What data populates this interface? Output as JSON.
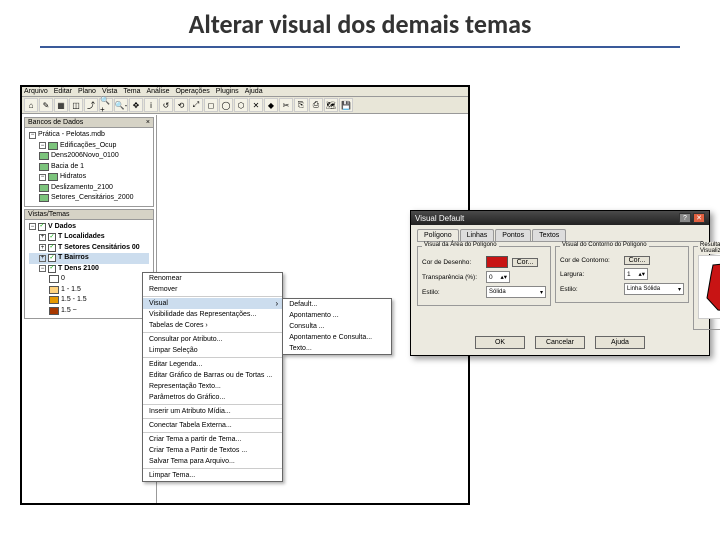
{
  "title": "Alterar visual dos demais temas",
  "menubar": [
    "Arquivo",
    "Editar",
    "Plano",
    "Vista",
    "Tema",
    "Análise",
    "Operações",
    "Plugins",
    "Ajuda"
  ],
  "toolbar_icons": [
    "⌂",
    "✎",
    "▦",
    "◫",
    "⤴",
    "🔍+",
    "🔍-",
    "✥",
    "i",
    "↺",
    "⟲",
    "⤢",
    "◻",
    "◯",
    "⬡",
    "✕",
    "◆",
    "✂",
    "⎘",
    "⎙",
    "🗺",
    "💾"
  ],
  "panels": {
    "db": {
      "title": "Bancos de Dados",
      "close": "×",
      "root": "Prática - Pelotas.mdb",
      "items": [
        "Edificações_Ocup",
        "Dens2006Novo_0100",
        "Bacia de 1",
        "Hidratos",
        "Deslizamento_2100",
        "Setores_Censitários_2000"
      ]
    },
    "views": {
      "title": "Vistas/Temas",
      "root": "V Dados",
      "themes": [
        {
          "label": "T Localidades",
          "chk": true
        },
        {
          "label": "T Setores Censitários 00",
          "chk": true
        },
        {
          "label": "T Bairros",
          "chk": true,
          "hl": true
        },
        {
          "label": "T Dens 2100",
          "chk": true
        }
      ],
      "legend": [
        {
          "range": "0",
          "color": "#ffffff"
        },
        {
          "range": "1 - 1.5",
          "color": "#ffd37f"
        },
        {
          "range": "1.5 - 1.5",
          "color": "#e69800"
        },
        {
          "range": "1.5 ~",
          "color": "#a83800"
        }
      ]
    }
  },
  "ctx": {
    "items": [
      {
        "t": "Renomear"
      },
      {
        "t": "Remover"
      },
      {
        "sep": true
      },
      {
        "t": "Visual",
        "sub": true,
        "hl": true
      },
      {
        "t": "Visibilidade das Representações..."
      },
      {
        "t": "Tabelas de Cores ›"
      },
      {
        "sep": true
      },
      {
        "t": "Consultar por Atributo..."
      },
      {
        "t": "Limpar Seleção"
      },
      {
        "sep": true
      },
      {
        "t": "Editar Legenda..."
      },
      {
        "t": "Editar Gráfico de Barras ou de Tortas ..."
      },
      {
        "t": "Representação Texto..."
      },
      {
        "t": "Parâmetros do Gráfico..."
      },
      {
        "sep": true
      },
      {
        "t": "Inserir um Atributo Mídia..."
      },
      {
        "sep": true
      },
      {
        "t": "Conectar Tabela Externa..."
      },
      {
        "sep": true
      },
      {
        "t": "Criar Tema a partir de Tema..."
      },
      {
        "t": "Criar Tema a Partir de Textos ..."
      },
      {
        "t": "Salvar Tema para Arquivo..."
      },
      {
        "sep": true
      },
      {
        "t": "Limpar Tema..."
      }
    ],
    "sub": [
      "Default...",
      "Apontamento ...",
      "Consulta ...",
      "Apontamento e Consulta...",
      "Texto..."
    ]
  },
  "dialog": {
    "title": "Visual Default",
    "tabs": [
      "Polígono",
      "Linhas",
      "Pontos",
      "Textos"
    ],
    "group_area": "Visual da Área do Polígono",
    "group_outline": "Visual do Contorno do Polígono",
    "group_result": "Resultado da Visualização",
    "lbl_fill": "Cor de Desenho:",
    "lbl_fillbtn": "Cor...",
    "lbl_transp": "Transparência (%):",
    "val_transp": "0",
    "lbl_style": "Estilo:",
    "val_style": "Sólida",
    "lbl_outline": "Cor de Contorno:",
    "lbl_outlinebtn": "Cor...",
    "lbl_width": "Largura:",
    "val_width": "1",
    "lbl_ostyle": "Estilo:",
    "val_ostyle": "Linha Sólida",
    "btn_ok": "OK",
    "btn_cancel": "Cancelar",
    "btn_help": "Ajuda"
  }
}
